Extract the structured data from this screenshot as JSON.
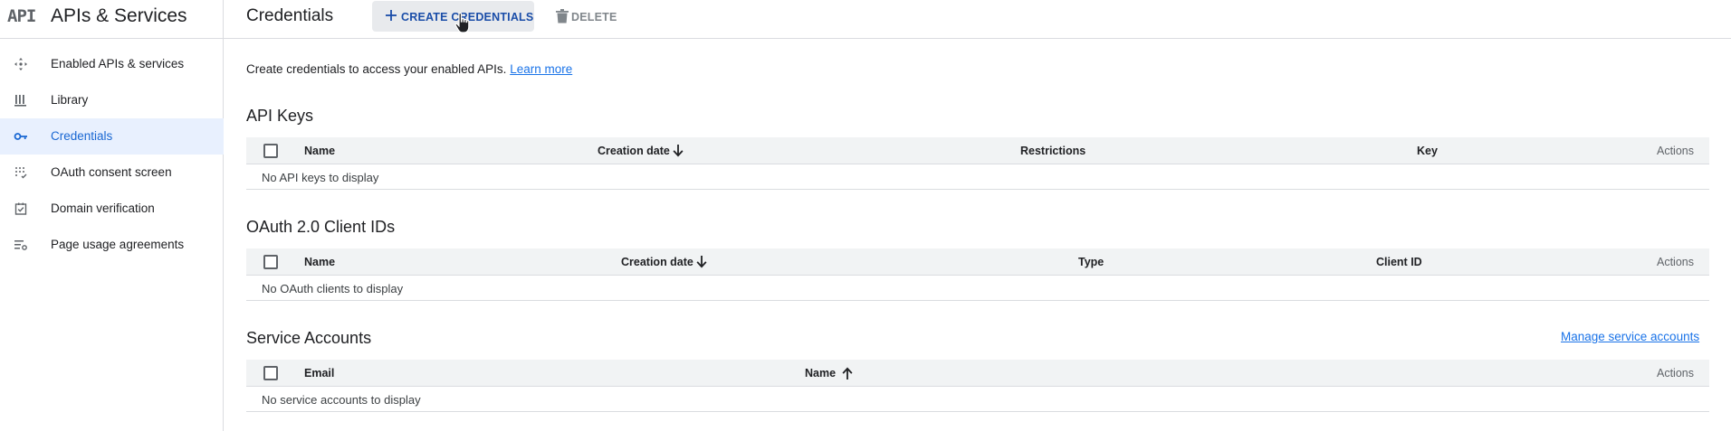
{
  "sidebar": {
    "logo_text": "API",
    "title": "APIs & Services",
    "items": [
      {
        "label": "Enabled APIs & services",
        "icon": "diamond-arrows-icon"
      },
      {
        "label": "Library",
        "icon": "library-icon"
      },
      {
        "label": "Credentials",
        "icon": "key-icon",
        "active": true
      },
      {
        "label": "OAuth consent screen",
        "icon": "dots-grid-icon"
      },
      {
        "label": "Domain verification",
        "icon": "checkbox-square-icon"
      },
      {
        "label": "Page usage agreements",
        "icon": "list-settings-icon"
      }
    ]
  },
  "header": {
    "title": "Credentials",
    "create_label": "CREATE CREDENTIALS",
    "delete_label": "DELETE"
  },
  "main": {
    "intro_text": "Create credentials to access your enabled APIs.",
    "learn_more": "Learn more",
    "api_keys": {
      "title": "API Keys",
      "columns": [
        "Name",
        "Creation date",
        "Restrictions",
        "Key",
        "Actions"
      ],
      "empty": "No API keys to display"
    },
    "oauth": {
      "title": "OAuth 2.0 Client IDs",
      "columns": [
        "Name",
        "Creation date",
        "Type",
        "Client ID",
        "Actions"
      ],
      "empty": "No OAuth clients to display"
    },
    "service_accounts": {
      "title": "Service Accounts",
      "manage_link": "Manage service accounts",
      "columns": [
        "Email",
        "Name",
        "Actions"
      ],
      "empty": "No service accounts to display"
    }
  },
  "colors": {
    "accent": "#1a73e8",
    "active_bg": "#e8f0fe",
    "header_bg": "#f1f3f4"
  }
}
